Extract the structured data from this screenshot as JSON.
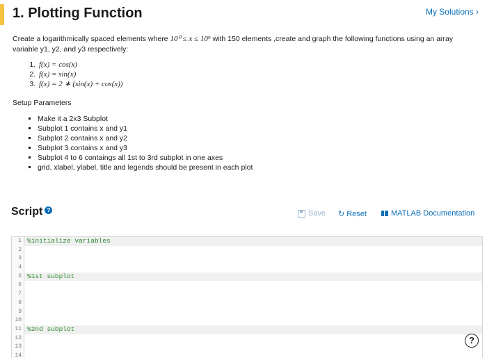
{
  "header": {
    "title": "1. Plotting Function",
    "my_solutions": "My Solutions ›"
  },
  "problem": {
    "desc_1": "Create a logarithmically spaced elements where ",
    "desc_math": "10⁰ ≤ x ≤ 10⁹",
    "desc_2": " with 150 elements ,create and graph the following functions using an array variable y1, y2, and y3 respectively:",
    "functions": [
      "f(x) = cos(x)",
      "f(x) = sin(x)",
      "f(x) = 2 ∗ (sin(x) + cos(x))"
    ],
    "setup_title": "Setup Parameters",
    "setup_items": [
      "Make it a 2x3 Subplot",
      "Subplot 1 contains x and y1",
      "Subplot 2 contains x and y2",
      "Subplot 3 contains x and y3",
      "Subplot 4 to 6 contaings all 1st to 3rd subplot in one axes",
      "grid, xlabel, ylabel, title and legends should be present in each plot"
    ]
  },
  "script": {
    "title": "Script",
    "help_glyph": "?",
    "save_label": "Save",
    "reset_label": "Reset",
    "reset_glyph": "↻",
    "docs_label": "MATLAB Documentation",
    "lines": [
      {
        "n": "1",
        "text": "%initialize variables"
      },
      {
        "n": "2",
        "text": ""
      },
      {
        "n": "3",
        "text": ""
      },
      {
        "n": "4",
        "text": ""
      },
      {
        "n": "5",
        "text": "%1st subplot"
      },
      {
        "n": "6",
        "text": ""
      },
      {
        "n": "7",
        "text": ""
      },
      {
        "n": "8",
        "text": ""
      },
      {
        "n": "9",
        "text": ""
      },
      {
        "n": "10",
        "text": ""
      },
      {
        "n": "11",
        "text": "%2nd subplot"
      },
      {
        "n": "12",
        "text": ""
      },
      {
        "n": "13",
        "text": ""
      },
      {
        "n": "14",
        "text": ""
      }
    ]
  },
  "floating_help": "?",
  "colors": {
    "accent": "#f5c242",
    "link": "#0a6fb7",
    "code_comment": "#2e8b2e"
  }
}
